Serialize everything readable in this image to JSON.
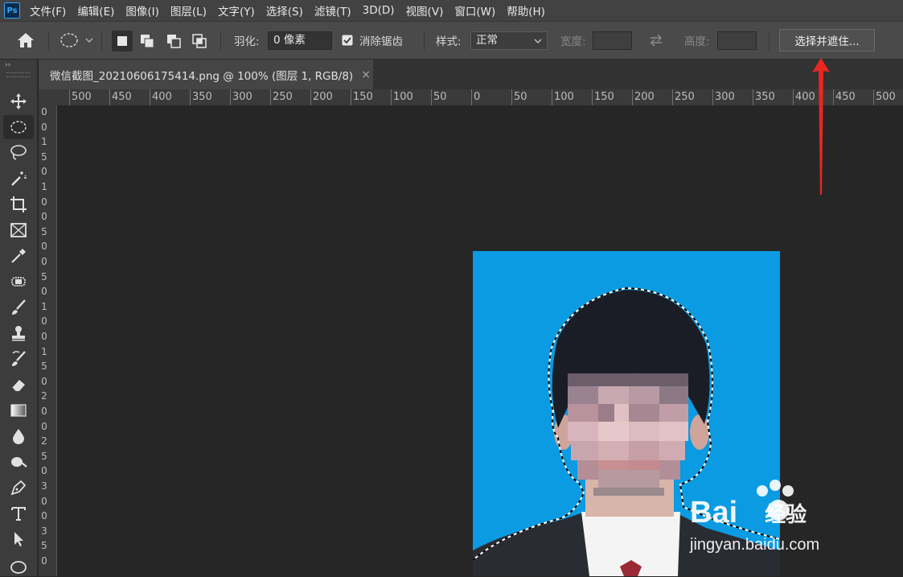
{
  "menubar": {
    "logo": "Ps",
    "items": [
      "文件(F)",
      "编辑(E)",
      "图像(I)",
      "图层(L)",
      "文字(Y)",
      "选择(S)",
      "滤镜(T)",
      "3D(D)",
      "视图(V)",
      "窗口(W)",
      "帮助(H)"
    ]
  },
  "options": {
    "feather_label": "羽化:",
    "feather_value": "0 像素",
    "antialias_label": "消除锯齿",
    "antialias_checked": true,
    "style_label": "样式:",
    "style_value": "正常",
    "width_label": "宽度:",
    "height_label": "高度:",
    "select_mask_button": "选择并遮住..."
  },
  "document": {
    "tab_title": "微信截图_20210606175414.png @ 100% (图层 1, RGB/8)",
    "close": "×"
  },
  "ruler": {
    "top_labels": [
      "500",
      "450",
      "400",
      "350",
      "300",
      "250",
      "200",
      "150",
      "100",
      "50",
      "0",
      "50",
      "100",
      "150",
      "200",
      "250",
      "300",
      "350",
      "400",
      "450",
      "500"
    ],
    "left_labels": [
      "0",
      "0",
      "1",
      "5",
      "0",
      "1",
      "0",
      "0",
      "5",
      "0",
      "0",
      "5",
      "0",
      "1",
      "0",
      "0",
      "1",
      "5",
      "0",
      "2",
      "0",
      "0",
      "2",
      "5",
      "0",
      "3",
      "0",
      "0",
      "3",
      "5",
      "0"
    ]
  },
  "tools": [
    "move-tool-icon",
    "elliptical-marquee-icon",
    "lasso-icon",
    "magic-wand-icon",
    "crop-icon",
    "frame-icon",
    "eyedropper-icon",
    "healing-brush-icon",
    "brush-icon",
    "clone-stamp-icon",
    "history-brush-icon",
    "eraser-icon",
    "gradient-icon",
    "blur-icon",
    "dodge-icon",
    "pen-icon",
    "type-icon",
    "path-selection-icon",
    "shape-icon"
  ],
  "watermark": {
    "brand_left": "Bai",
    "brand_right": "经验",
    "url": "jingyan.baidu.com"
  },
  "colors": {
    "photo_background": "#0a9be2",
    "annotation_arrow": "#e8271f"
  }
}
